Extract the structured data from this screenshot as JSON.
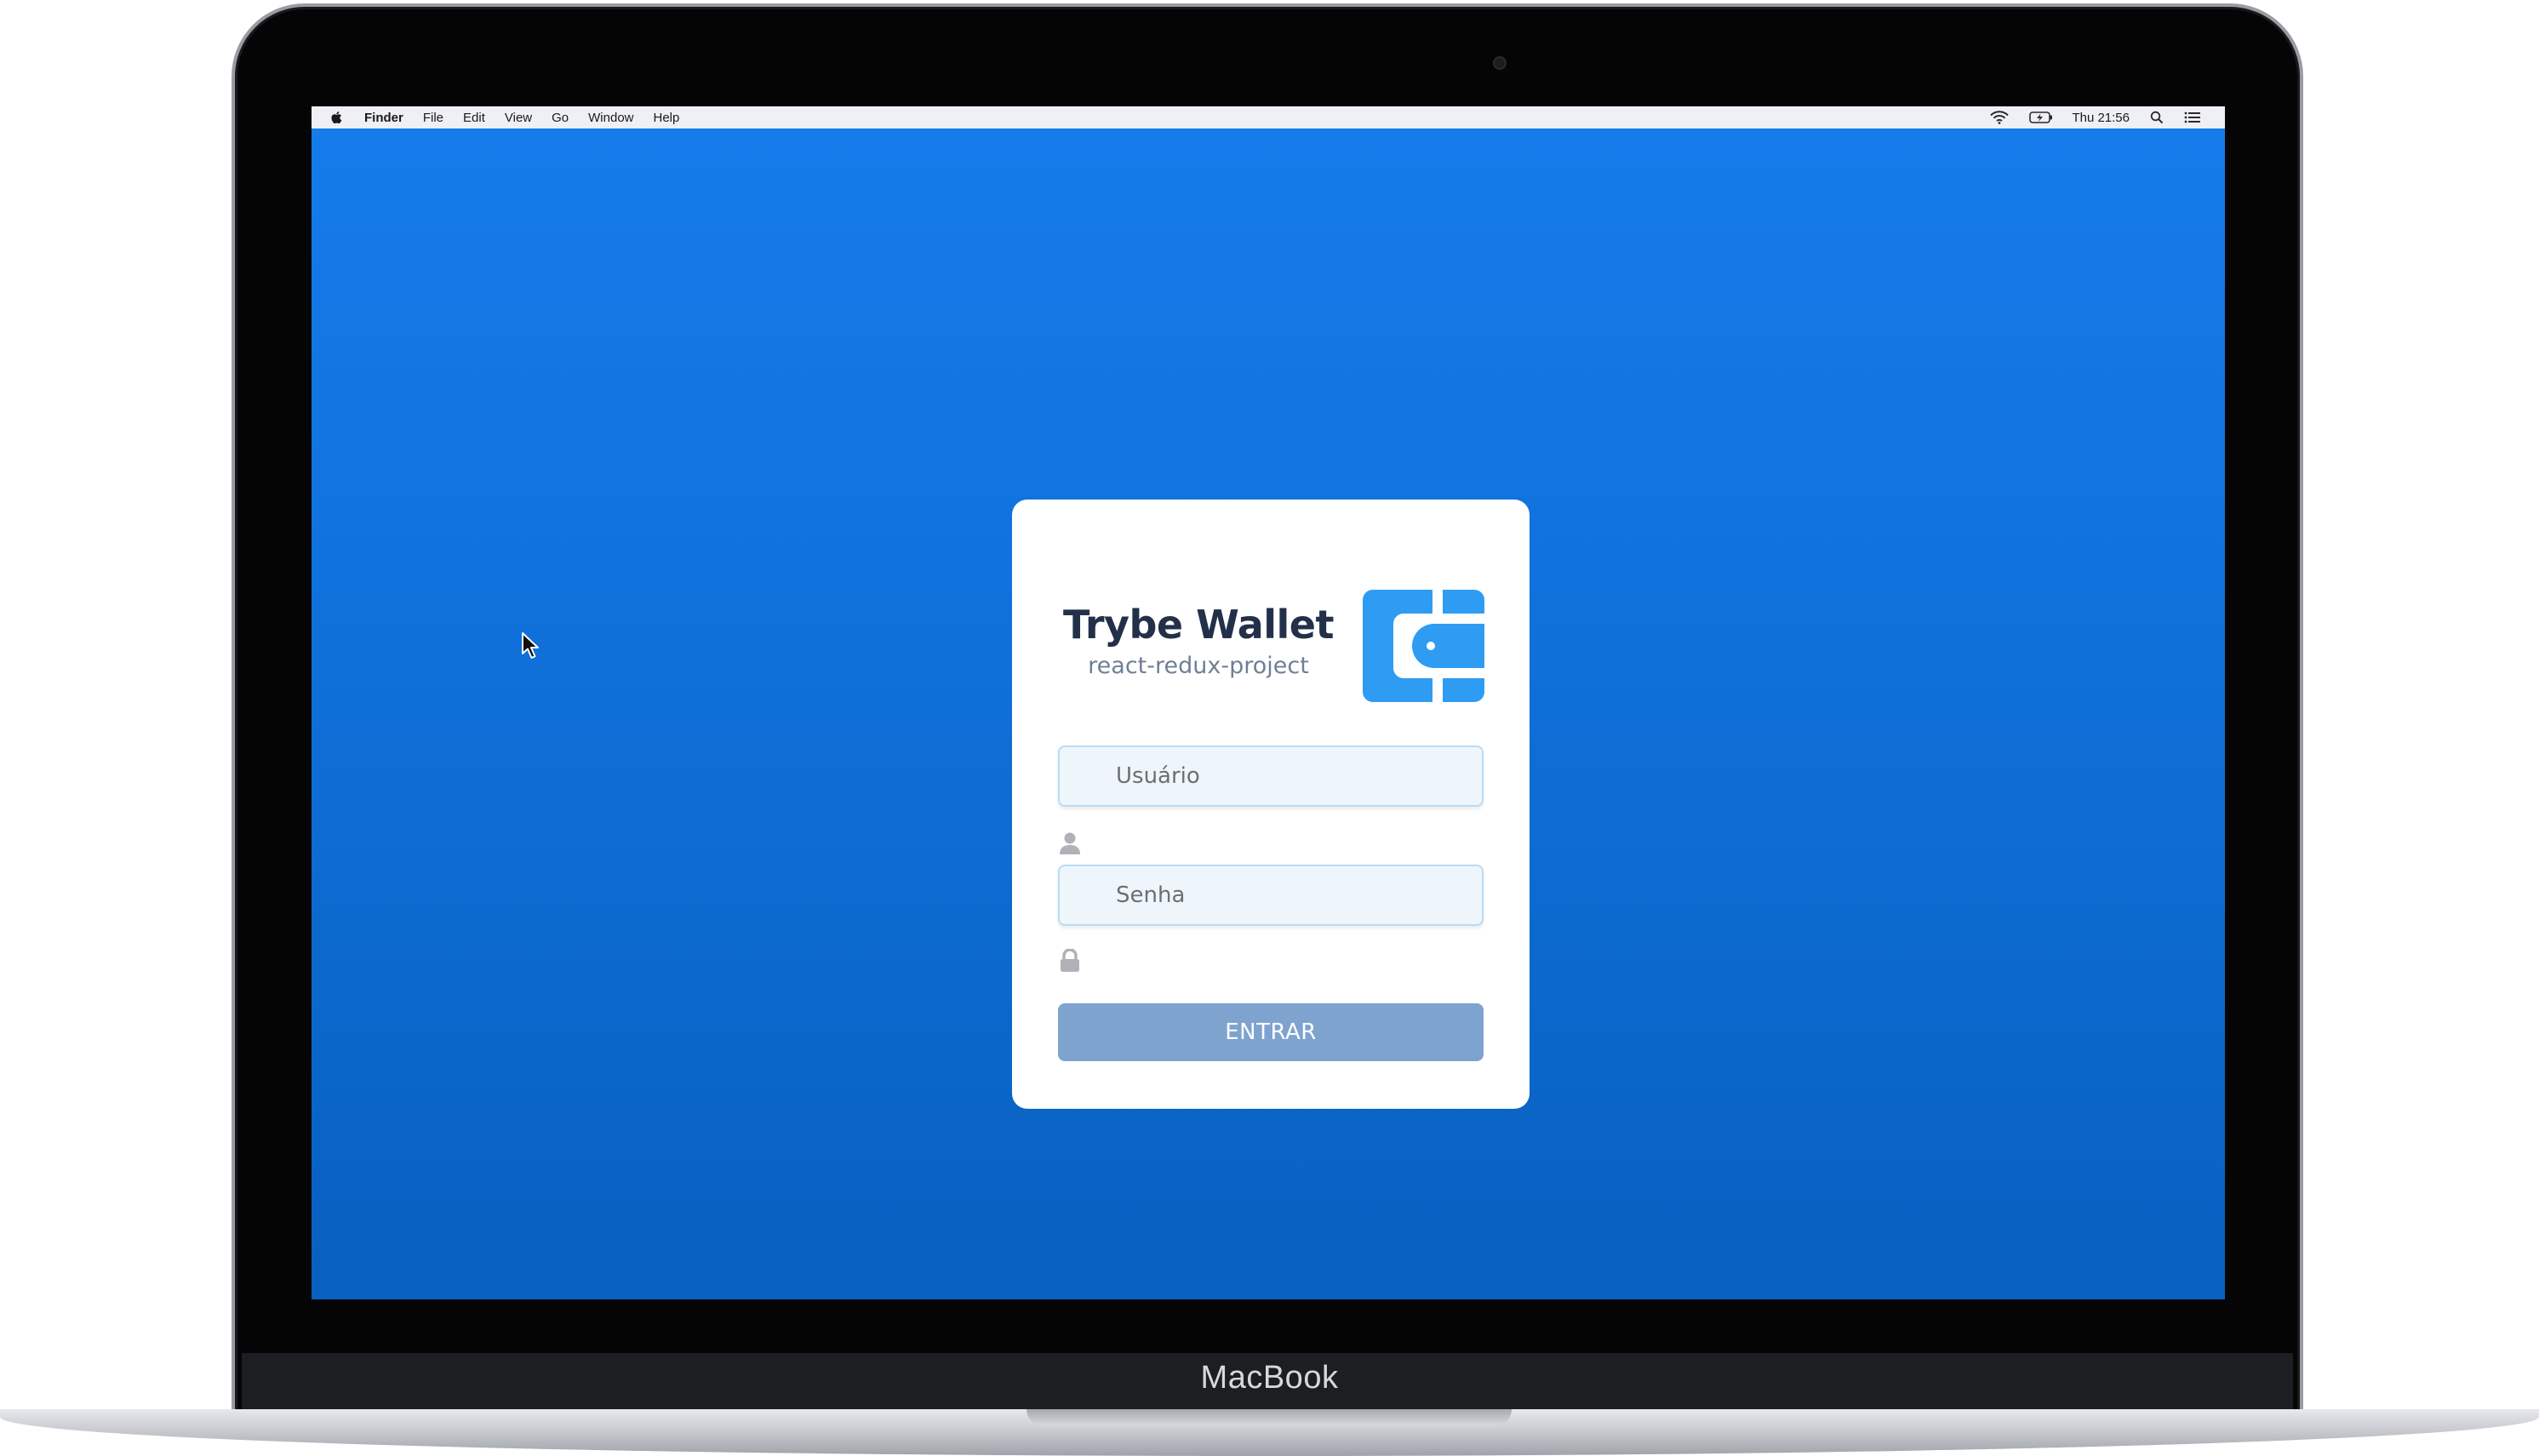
{
  "device": {
    "brand_label": "MacBook"
  },
  "menubar": {
    "apple_icon": "apple-logo-icon",
    "app_name": "Finder",
    "items": [
      "File",
      "Edit",
      "View",
      "Go",
      "Window",
      "Help"
    ],
    "status_icons": [
      "wifi-icon",
      "battery-charging-icon"
    ],
    "clock": "Thu 21:56",
    "right_icons": [
      "spotlight-search-icon",
      "notification-center-icon"
    ]
  },
  "desktop": {
    "background_top": "#157ceb",
    "background_bottom": "#0860bf"
  },
  "login": {
    "title": "Trybe Wallet",
    "subtitle": "react-redux-project",
    "logo_icon": "wallet-logo-icon",
    "logo_color": "#2f9cf3",
    "username": {
      "placeholder": "Usuário",
      "value": "",
      "icon": "user-icon"
    },
    "password": {
      "placeholder": "Senha",
      "value": "",
      "icon": "lock-icon"
    },
    "submit_label": "ENTRAR",
    "submit_color": "#7ea3ce",
    "submit_disabled": true
  }
}
